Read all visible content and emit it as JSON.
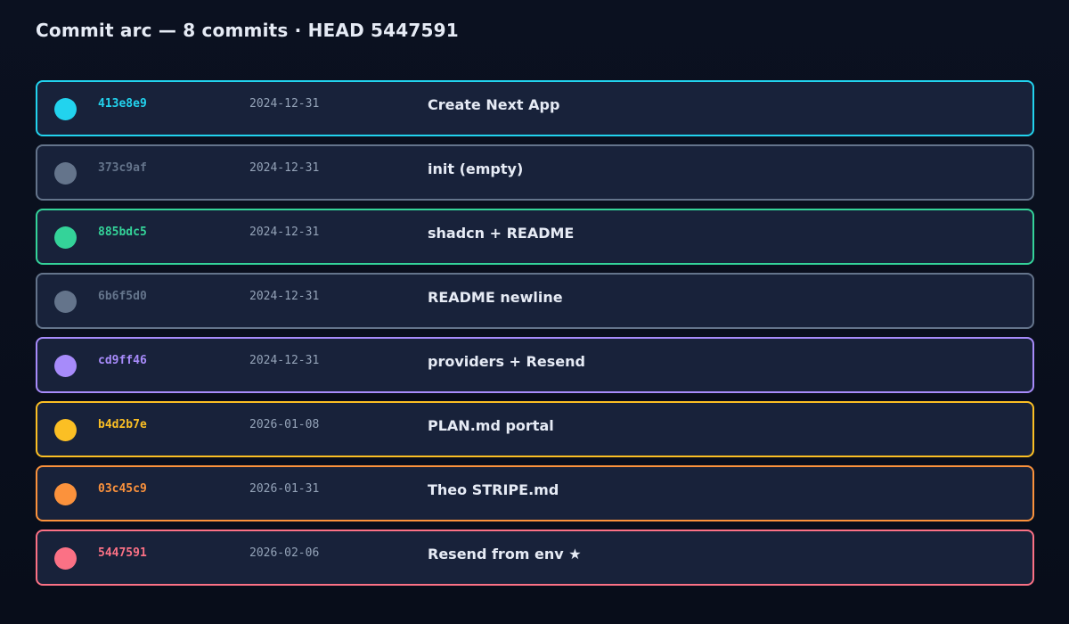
{
  "header": {
    "title": "Commit arc — 8 commits · HEAD 5447591"
  },
  "commits": [
    {
      "hash": "413e8e9",
      "date": "2024-12-31",
      "message": "Create Next App",
      "color": "#22d3ee"
    },
    {
      "hash": "373c9af",
      "date": "2024-12-31",
      "message": "init (empty)",
      "color": "#64748b"
    },
    {
      "hash": "885bdc5",
      "date": "2024-12-31",
      "message": "shadcn + README",
      "color": "#34d399"
    },
    {
      "hash": "6b6f5d0",
      "date": "2024-12-31",
      "message": "README newline",
      "color": "#64748b"
    },
    {
      "hash": "cd9ff46",
      "date": "2024-12-31",
      "message": "providers + Resend",
      "color": "#a78bfa"
    },
    {
      "hash": "b4d2b7e",
      "date": "2026-01-08",
      "message": "PLAN.md portal",
      "color": "#fbbf24"
    },
    {
      "hash": "03c45c9",
      "date": "2026-01-31",
      "message": "Theo STRIPE.md",
      "color": "#fb923c"
    },
    {
      "hash": "5447591",
      "date": "2026-02-06",
      "message": "Resend from env ★",
      "color": "#fb7185"
    }
  ]
}
